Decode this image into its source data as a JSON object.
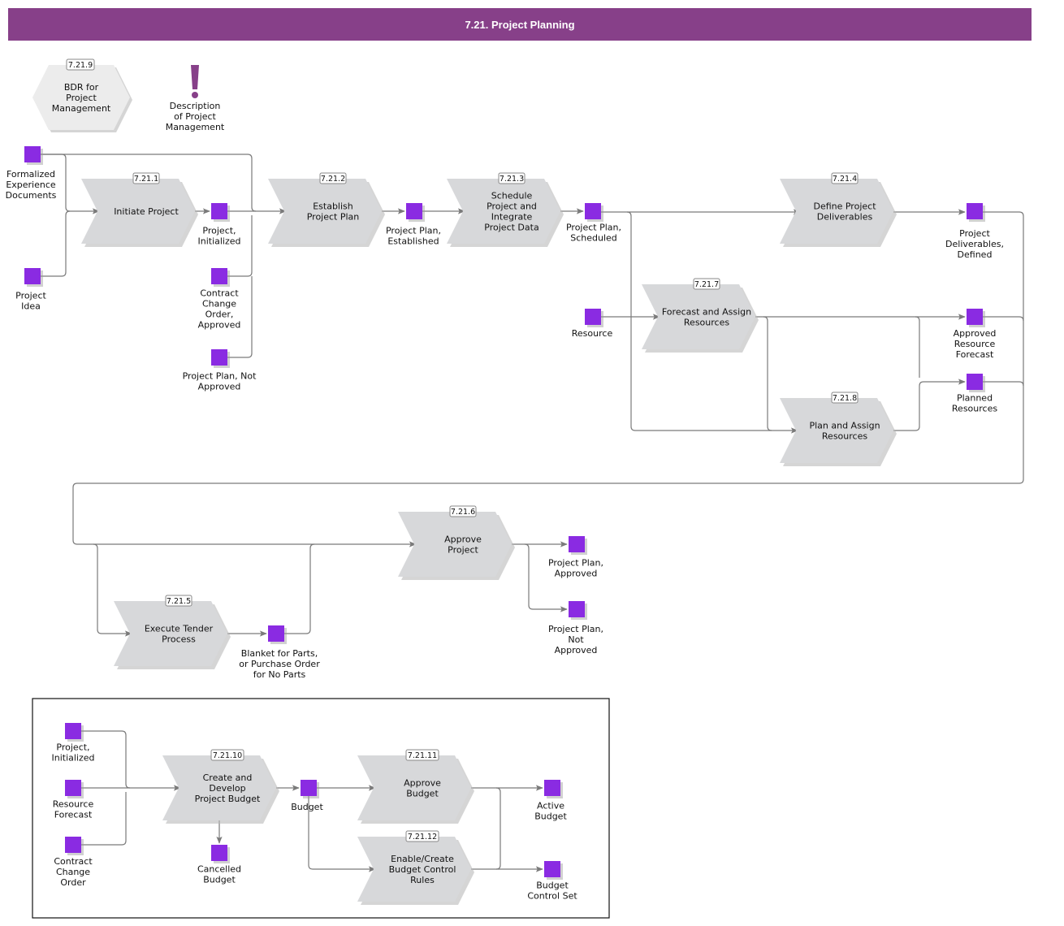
{
  "header": {
    "title": "7.21. Project Planning"
  },
  "colors": {
    "header": "#874089",
    "event": "#8a2be2",
    "function": "#d7d8da",
    "connector": "#7a7a7a"
  },
  "reference": {
    "id": "7.21.9",
    "label": "BDR for Project Management"
  },
  "note": {
    "icon": "exclamation-icon",
    "label": "Description of Project Management"
  },
  "functions": [
    {
      "key": "initiate",
      "id": "7.21.1",
      "label": "Initiate Project"
    },
    {
      "key": "establish",
      "id": "7.21.2",
      "label": "Establish Project Plan"
    },
    {
      "key": "schedule",
      "id": "7.21.3",
      "label": "Schedule Project and Integrate Project Data"
    },
    {
      "key": "define",
      "id": "7.21.4",
      "label": "Define Project Deliverables"
    },
    {
      "key": "forecast",
      "id": "7.21.7",
      "label": "Forecast and Assign Resources"
    },
    {
      "key": "planassign",
      "id": "7.21.8",
      "label": "Plan and Assign Resources"
    },
    {
      "key": "approve",
      "id": "7.21.6",
      "label": "Approve Project"
    },
    {
      "key": "tender",
      "id": "7.21.5",
      "label": "Execute Tender Process"
    },
    {
      "key": "budget",
      "id": "7.21.10",
      "label": "Create and Develop Project Budget"
    },
    {
      "key": "approvebudget",
      "id": "7.21.11",
      "label": "Approve Budget"
    },
    {
      "key": "controlrules",
      "id": "7.21.12",
      "label": "Enable/Create Budget Control Rules"
    }
  ],
  "events": [
    {
      "key": "formalized",
      "label": "Formalized Experience Documents"
    },
    {
      "key": "idea",
      "label": "Project Idea"
    },
    {
      "key": "initialized",
      "label": "Project, Initialized"
    },
    {
      "key": "cco_approved",
      "label": "Contract Change Order, Approved"
    },
    {
      "key": "plan_not_approved_in",
      "label": "Project Plan, Not Approved"
    },
    {
      "key": "established",
      "label": "Project Plan, Established"
    },
    {
      "key": "scheduled",
      "label": "Project Plan, Scheduled"
    },
    {
      "key": "deliverables",
      "label": "Project Deliverables, Defined"
    },
    {
      "key": "resource",
      "label": "Resource"
    },
    {
      "key": "approved_forecast",
      "label": "Approved Resource Forecast"
    },
    {
      "key": "planned_resources",
      "label": "Planned Resources"
    },
    {
      "key": "plan_approved",
      "label": "Project Plan, Approved"
    },
    {
      "key": "plan_not_approved_out",
      "label": "Project Plan, Not Approved"
    },
    {
      "key": "blanket",
      "label": "Blanket for Parts, or Purchase Order for No Parts"
    },
    {
      "key": "b_initialized",
      "label": "Project, Initialized"
    },
    {
      "key": "b_forecast",
      "label": "Resource Forecast"
    },
    {
      "key": "b_cco",
      "label": "Contract Change Order"
    },
    {
      "key": "b_cancelled",
      "label": "Cancelled Budget"
    },
    {
      "key": "b_budget",
      "label": "Budget"
    },
    {
      "key": "b_active",
      "label": "Active Budget"
    },
    {
      "key": "b_controlset",
      "label": "Budget Control Set"
    }
  ]
}
